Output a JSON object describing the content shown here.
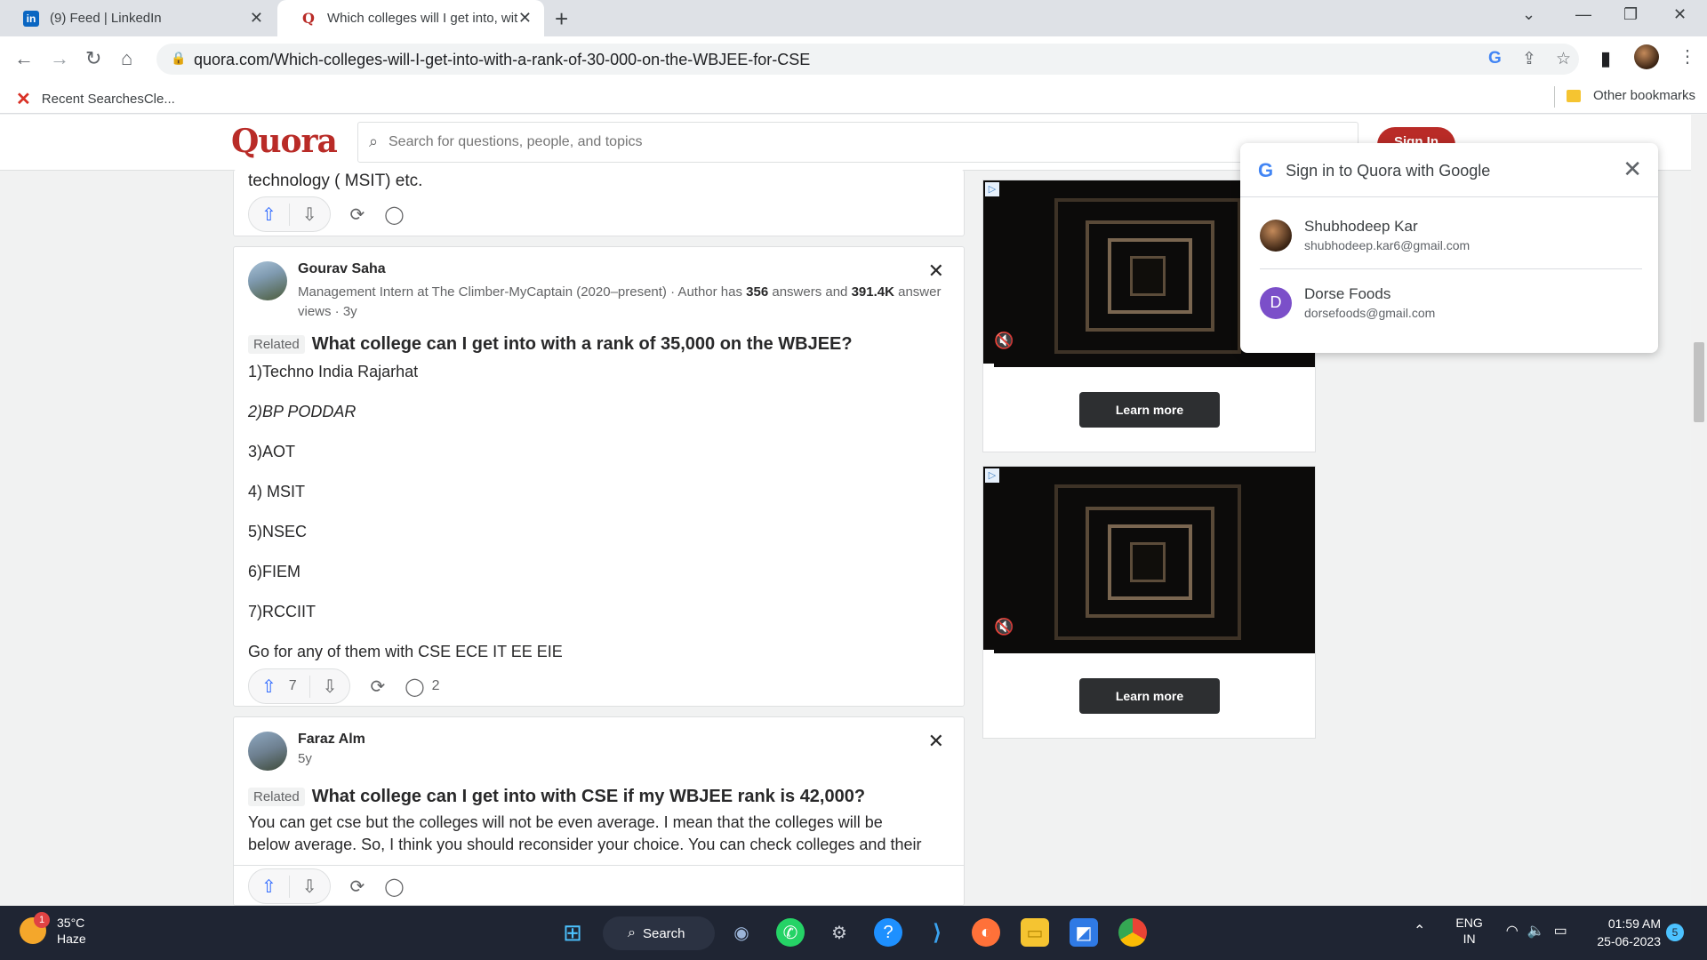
{
  "browser": {
    "tabs": [
      {
        "title": "(9) Feed | LinkedIn",
        "icon": "linkedin-icon"
      },
      {
        "title": "Which colleges will I get into, wit",
        "icon": "quora-icon"
      }
    ],
    "url": "quora.com/Which-colleges-will-I-get-into-with-a-rank-of-30-000-on-the-WBJEE-for-CSE",
    "bookmarks": {
      "first": "Recent SearchesCle...",
      "other": "Other bookmarks"
    }
  },
  "quora": {
    "logo": "Quora",
    "search_placeholder": "Search for questions, people, and topics",
    "signin_label": "Sign In",
    "prev_answer_tail": "technology ( MSIT) etc.",
    "answers": [
      {
        "author": "Gourav Saha",
        "meta_prefix": "Management Intern at The Climber-MyCaptain (2020–present) · Author has ",
        "answers_count": "356",
        "meta_mid": " answers and ",
        "views": "391.4K",
        "meta_suffix": " answer views · 3y",
        "related": "Related",
        "question": "What college can I get into with a rank of 35,000 on the WBJEE?",
        "lines": [
          "1)Techno India Rajarhat",
          "2)BP PODDAR",
          "3)AOT",
          "4) MSIT",
          "5)NSEC",
          "6)FIEM",
          "7)RCCIIT",
          "Go for any of them with CSE ECE IT EE EIE"
        ],
        "upvotes": "7",
        "comments": "2"
      },
      {
        "author": "Faraz Alm",
        "meta": "5y",
        "related": "Related",
        "question": "What college can I get into with CSE if my WBJEE rank is 42,000?",
        "lines": [
          "You can get cse but the colleges will not be even average. I mean that the colleges will be",
          "below average. So, I think you should reconsider your choice. You can check colleges and their"
        ]
      }
    ],
    "ads": [
      {
        "cta": "Learn more"
      },
      {
        "cta": "Learn more"
      }
    ]
  },
  "google_popup": {
    "title": "Sign in to Quora with Google",
    "accounts": [
      {
        "name": "Shubhodeep Kar",
        "email": "shubhodeep.kar6@gmail.com"
      },
      {
        "initial": "D",
        "name": "Dorse Foods",
        "email": "dorsefoods@gmail.com",
        "color": "#7b4fc9"
      }
    ]
  },
  "taskbar": {
    "weather_temp": "35°C",
    "weather_desc": "Haze",
    "weather_badge": "1",
    "search_label": "Search",
    "lang_top": "ENG",
    "lang_bottom": "IN",
    "time": "01:59 AM",
    "date": "25-06-2023",
    "notifications": "5"
  }
}
